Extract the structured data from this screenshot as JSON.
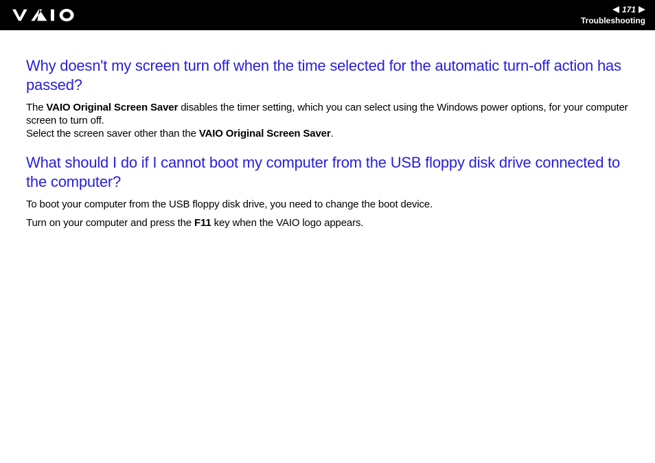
{
  "header": {
    "page_number": "171",
    "section_label": "Troubleshooting"
  },
  "sections": [
    {
      "question": "Why doesn't my screen turn off when the time selected for the automatic turn-off action has passed?",
      "para1_pre": "The ",
      "para1_bold1": "VAIO Original Screen Saver",
      "para1_mid": " disables the timer setting, which you can select using the Windows power options, for your computer screen to turn off.",
      "para1_line2_pre": "Select the screen saver other than the ",
      "para1_line2_bold": "VAIO Original Screen Saver",
      "para1_line2_post": "."
    },
    {
      "question": "What should I do if I cannot boot my computer from the USB floppy disk drive connected to the computer?",
      "para1": "To boot your computer from the USB floppy disk drive, you need to change the boot device.",
      "para2_pre": "Turn on your computer and press the ",
      "para2_bold": "F11",
      "para2_post": " key when the VAIO logo appears."
    }
  ]
}
